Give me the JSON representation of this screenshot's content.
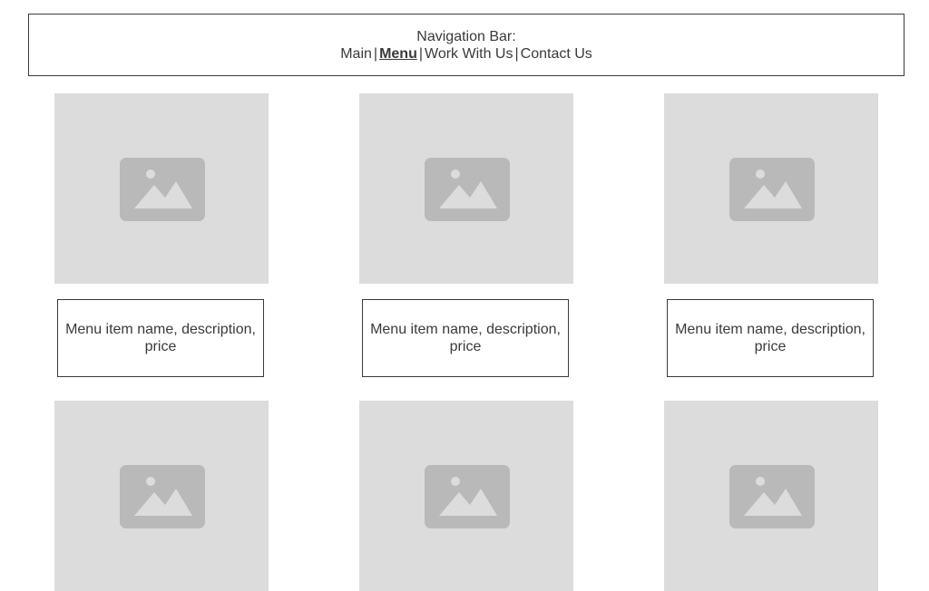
{
  "nav": {
    "title": "Navigation Bar:",
    "links": [
      {
        "label": "Main",
        "active": false
      },
      {
        "label": "Menu",
        "active": true
      },
      {
        "label": "Work With Us",
        "active": false
      },
      {
        "label": "Contact Us",
        "active": false
      }
    ],
    "separator": "|"
  },
  "menu_items": [
    {
      "caption": "Menu item name, description, price",
      "image_icon": "image-placeholder-icon"
    },
    {
      "caption": "Menu item name, description, price",
      "image_icon": "image-placeholder-icon"
    },
    {
      "caption": "Menu item name, description, price",
      "image_icon": "image-placeholder-icon"
    },
    {
      "image_icon": "image-placeholder-icon"
    },
    {
      "image_icon": "image-placeholder-icon"
    },
    {
      "image_icon": "image-placeholder-icon"
    }
  ],
  "colors": {
    "placeholder_bg": "#dcdcdc",
    "placeholder_icon": "#b9b9b9",
    "text": "#3a3a3a",
    "border": "#3a3a3a"
  }
}
